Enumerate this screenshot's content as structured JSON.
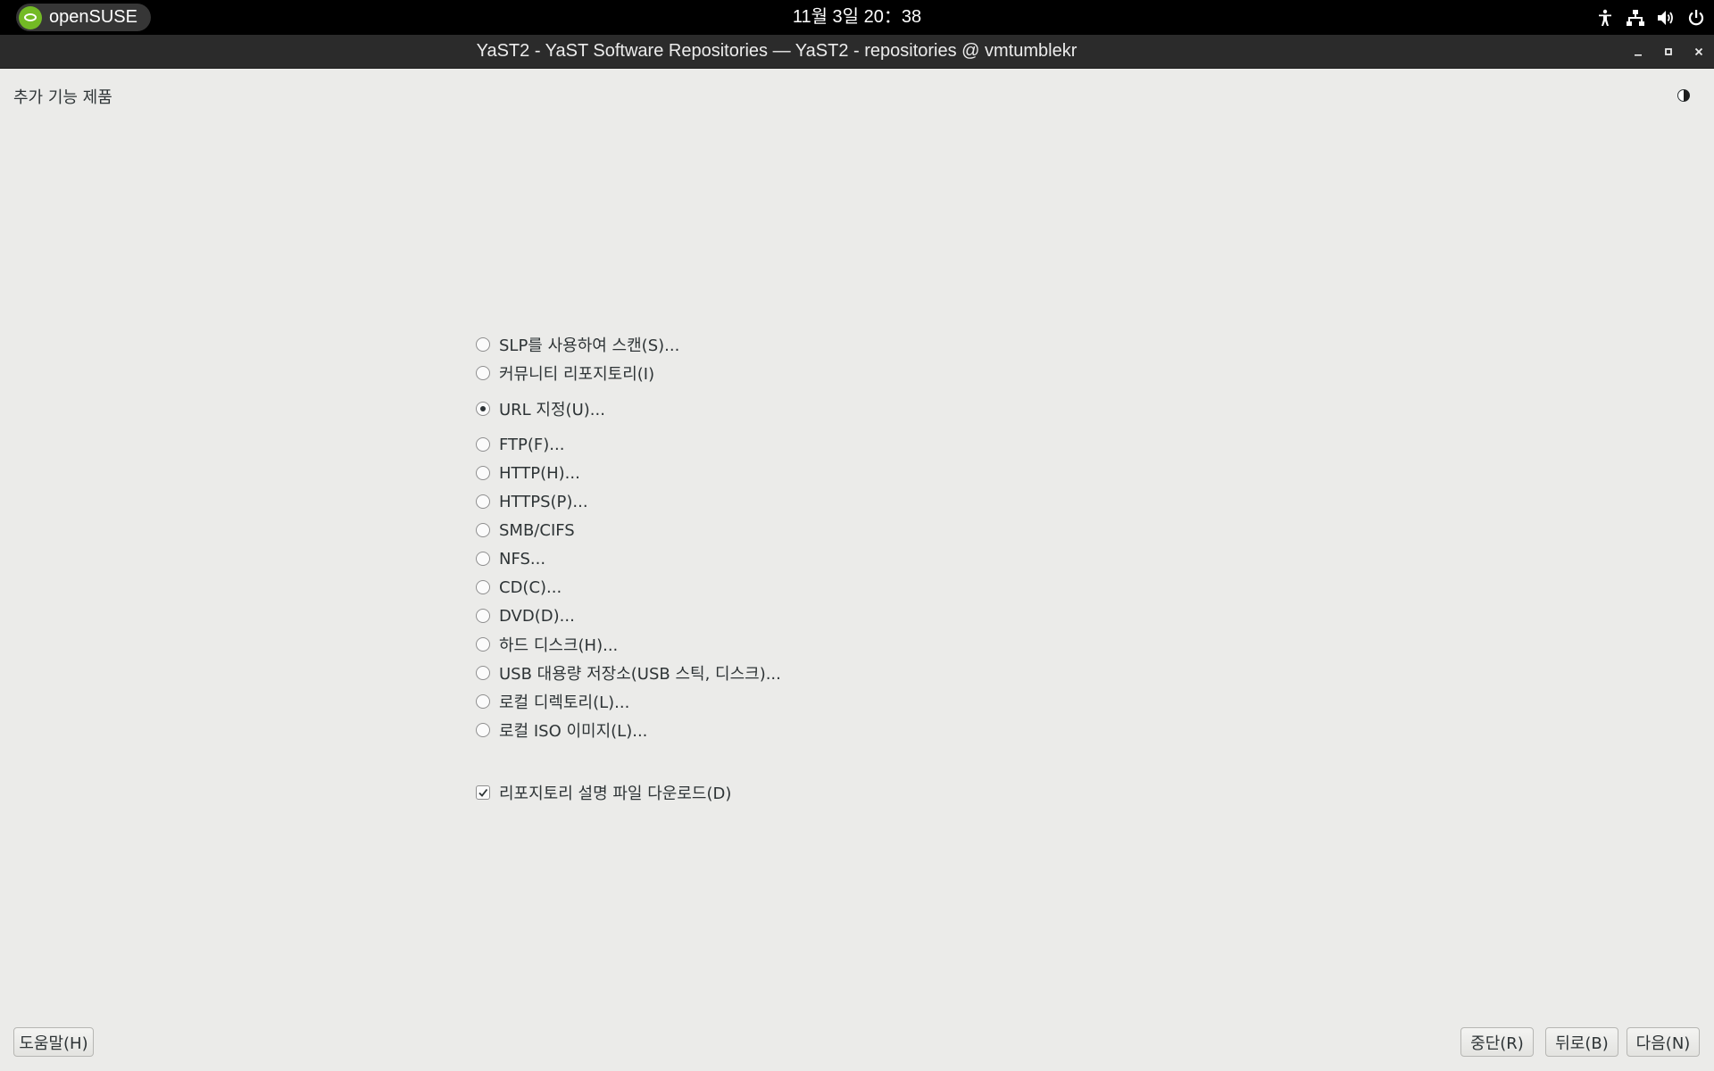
{
  "topbar": {
    "activities_label": "openSUSE",
    "clock": "11월 3일  20：38",
    "tray_icons": [
      "accessibility-icon",
      "network-icon",
      "volume-icon",
      "power-icon"
    ]
  },
  "window": {
    "title": "YaST2 - YaST Software Repositories — YaST2 - repositories @ vmtumblekr"
  },
  "page": {
    "title": "추가 기능 제품"
  },
  "options": [
    {
      "label": "SLP를 사용하여 스캔(S)...",
      "checked": false
    },
    {
      "label": "커뮤니티 리포지토리(I)",
      "checked": false
    },
    {
      "label": "URL 지정(U)...",
      "checked": true
    },
    {
      "label": "FTP(F)...",
      "checked": false
    },
    {
      "label": "HTTP(H)...",
      "checked": false
    },
    {
      "label": "HTTPS(P)...",
      "checked": false
    },
    {
      "label": "SMB/CIFS",
      "checked": false
    },
    {
      "label": "NFS...",
      "checked": false
    },
    {
      "label": "CD(C)...",
      "checked": false
    },
    {
      "label": "DVD(D)...",
      "checked": false
    },
    {
      "label": "하드 디스크(H)...",
      "checked": false
    },
    {
      "label": "USB 대용량 저장소(USB 스틱, 디스크)...",
      "checked": false
    },
    {
      "label": "로컬 디렉토리(L)...",
      "checked": false
    },
    {
      "label": "로컬 ISO 이미지(L)...",
      "checked": false
    }
  ],
  "download_checkbox": {
    "label": "리포지토리 설명 파일 다운로드(D)",
    "checked": true
  },
  "buttons": {
    "help": "도움말(H)",
    "abort": "중단(R)",
    "back": "뒤로(B)",
    "next": "다음(N)"
  }
}
